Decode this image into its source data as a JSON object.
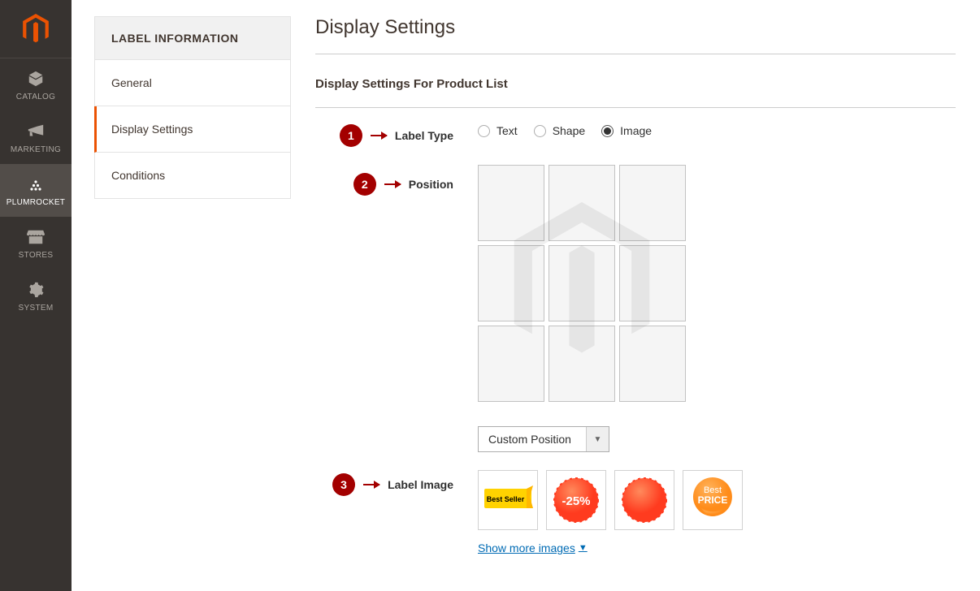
{
  "sidebar": {
    "items": [
      {
        "label": "CATALOG",
        "id": "catalog"
      },
      {
        "label": "MARKETING",
        "id": "marketing"
      },
      {
        "label": "PLUMROCKET",
        "id": "plumrocket"
      },
      {
        "label": "STORES",
        "id": "stores"
      },
      {
        "label": "SYSTEM",
        "id": "system"
      }
    ],
    "active_index": 2
  },
  "tabs": {
    "header": "LABEL INFORMATION",
    "items": [
      {
        "label": "General"
      },
      {
        "label": "Display Settings"
      },
      {
        "label": "Conditions"
      }
    ],
    "active_index": 1
  },
  "page": {
    "title": "Display Settings",
    "section_title": "Display Settings For Product List"
  },
  "annotations": [
    {
      "num": "1"
    },
    {
      "num": "2"
    },
    {
      "num": "3"
    }
  ],
  "fields": {
    "label_type": {
      "label": "Label Type",
      "options": [
        {
          "label": "Text",
          "selected": false
        },
        {
          "label": "Shape",
          "selected": false
        },
        {
          "label": "Image",
          "selected": true
        }
      ]
    },
    "position": {
      "label": "Position",
      "dropdown_label": "Custom Position"
    },
    "label_image": {
      "label": "Label Image",
      "tiles": [
        {
          "type": "best-seller",
          "text": "Best Seller"
        },
        {
          "type": "discount",
          "text": "-25%"
        },
        {
          "type": "circle",
          "text": ""
        },
        {
          "type": "best-price",
          "text_top": "Best",
          "text_bottom": "PRICE"
        }
      ],
      "show_more": "Show more images"
    }
  },
  "colors": {
    "accent": "#eb5202",
    "annotation": "#a30000",
    "link": "#006bb4"
  }
}
